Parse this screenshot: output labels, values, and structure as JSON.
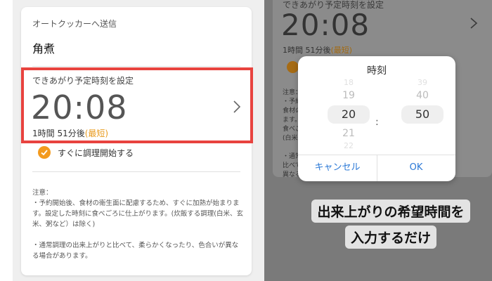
{
  "left": {
    "section_label": "オートクッカーへ送信",
    "recipe_name": "角煮",
    "time_label": "できあがり予定時刻を設定",
    "time": "20:08",
    "remaining": "1時間 51分後",
    "remaining_tag": "(最短)",
    "start_now_label": "すぐに調理開始する",
    "notes": "注意：\n・予約開始後、食材の衛生面に配慮するため、すぐに加熱が始まります。設定した時刻に食べごろに仕上がります。(炊飯する調理(白米、玄米、粥など）は除く)\n\n・通常調理の出来上がりと比べて、柔らかくなったり、色合いが異なる場合があります。"
  },
  "right": {
    "top_label": "できあがり予定時刻を設定",
    "time": "20:08",
    "remaining": "1時間 51分後",
    "remaining_tag": "(最短)",
    "notes": "注意：\n・予約\n食材の衛生面に配慮する ため、すぐに加熱が始まり\nます。設\n食べごろに仕上がります。(炊飯する調理\n(白米\n\n・通常\n比べて、柔らかくなったり、色合いが\n異なる"
  },
  "time_picker": {
    "title": "時刻",
    "hours": [
      "18",
      "19",
      "20",
      "21",
      "22"
    ],
    "minutes": [
      "39",
      "40",
      "50",
      "",
      ""
    ],
    "selected_hour": "20",
    "selected_minute": "50",
    "colon": ":",
    "cancel_label": "キャンセル",
    "ok_label": "OK"
  },
  "caption": {
    "line1": "出来上がりの希望時間を",
    "line2": "入力するだけ"
  },
  "colors": {
    "highlight": "#e8433f",
    "accent_orange": "#f39a1e",
    "link_blue": "#2a78d6"
  }
}
